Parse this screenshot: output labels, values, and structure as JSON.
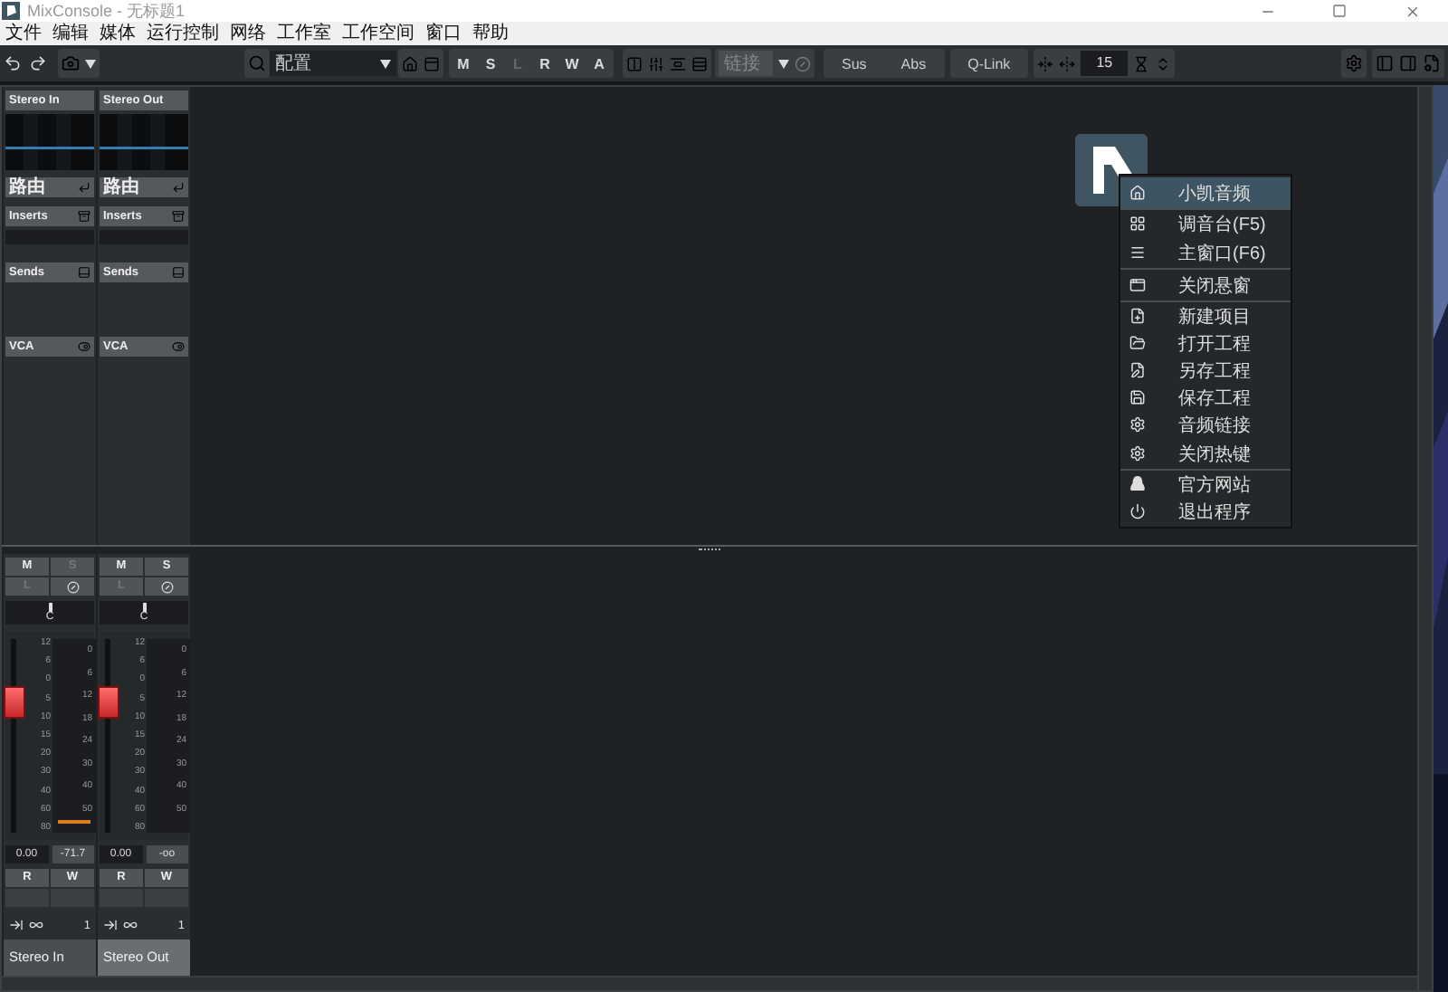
{
  "window": {
    "title": "MixConsole - 无标题1"
  },
  "menu_bar": [
    "文件",
    "编辑",
    "媒体",
    "运行控制",
    "网络",
    "工作室",
    "工作空间",
    "窗口",
    "帮助"
  ],
  "toolbar": {
    "preset": "配置",
    "mix_buttons": [
      {
        "label": "M",
        "disabled": false
      },
      {
        "label": "S",
        "disabled": false
      },
      {
        "label": "L",
        "disabled": true
      },
      {
        "label": "R",
        "disabled": false
      },
      {
        "label": "W",
        "disabled": false
      },
      {
        "label": "A",
        "disabled": false
      }
    ],
    "link": {
      "placeholder": "链接"
    },
    "sus": "Sus",
    "abs": "Abs",
    "q_link": "Q-Link",
    "width_value": "15"
  },
  "channels": [
    {
      "name": "Stereo In",
      "routing": "路由",
      "inserts": "Inserts",
      "sends": "Sends",
      "vca": "VCA",
      "mute": {
        "label": "M",
        "disabled": false
      },
      "solo": {
        "label": "S",
        "disabled": true
      },
      "listen": {
        "label": "L",
        "disabled": true
      },
      "pan": "C",
      "fader_scale": [
        "12",
        "6",
        "0",
        "5",
        "10",
        "15",
        "20",
        "30",
        "40",
        "60",
        "80"
      ],
      "meter_scale": [
        "0",
        "6",
        "12",
        "18",
        "24",
        "30",
        "40",
        "50"
      ],
      "level": 0.71,
      "peak": true,
      "volume": "0.00",
      "meter_reading": "-71.7",
      "read": "R",
      "write": "W",
      "output": "1",
      "footer_name": "Stereo In",
      "footer_selected": false
    },
    {
      "name": "Stereo Out",
      "routing": "路由",
      "inserts": "Inserts",
      "sends": "Sends",
      "vca": "VCA",
      "mute": {
        "label": "M",
        "disabled": false
      },
      "solo": {
        "label": "S",
        "disabled": false
      },
      "listen": {
        "label": "L",
        "disabled": true
      },
      "pan": "C",
      "fader_scale": [
        "12",
        "6",
        "0",
        "5",
        "10",
        "15",
        "20",
        "30",
        "40",
        "60",
        "80"
      ],
      "meter_scale": [
        "0",
        "6",
        "12",
        "18",
        "24",
        "30",
        "40",
        "50"
      ],
      "level": 0.71,
      "peak": false,
      "volume": "0.00",
      "meter_reading": "-oo",
      "read": "R",
      "write": "W",
      "output": "1",
      "footer_name": "Stereo Out",
      "footer_selected": true
    }
  ],
  "context_menu": {
    "items": [
      {
        "label": "小凯音频",
        "selected": true,
        "divider_after": true
      },
      {
        "label": "调音台(F5)",
        "selected": false,
        "divider_after": false
      },
      {
        "label": "主窗口(F6)",
        "selected": false,
        "divider_after": true
      },
      {
        "label": "关闭悬窗",
        "selected": false,
        "divider_after": true
      },
      {
        "label": "新建项目",
        "selected": false,
        "divider_after": false
      },
      {
        "label": "打开工程",
        "selected": false,
        "divider_after": false
      },
      {
        "label": "另存工程",
        "selected": false,
        "divider_after": false
      },
      {
        "label": "保存工程",
        "selected": false,
        "divider_after": false
      },
      {
        "label": "音频链接",
        "selected": false,
        "divider_after": false
      },
      {
        "label": "关闭热键",
        "selected": false,
        "divider_after": true
      },
      {
        "label": "官方网站",
        "selected": false,
        "divider_after": false
      },
      {
        "label": "退出程序",
        "selected": false,
        "divider_after": false
      }
    ]
  }
}
